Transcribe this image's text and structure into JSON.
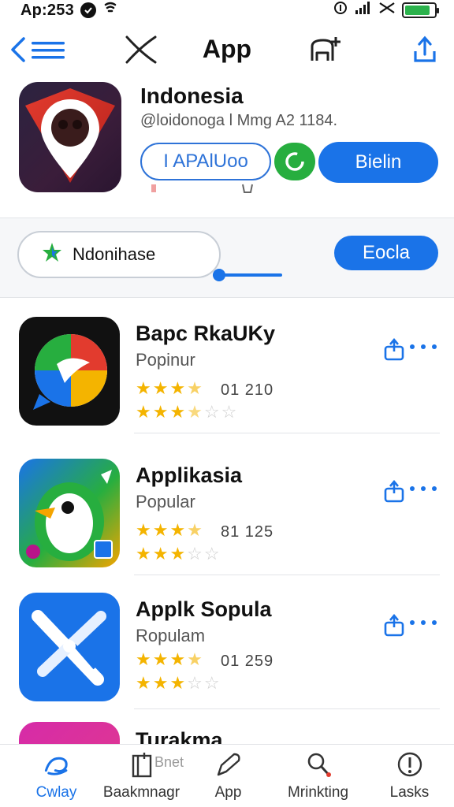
{
  "status": {
    "time": "Ap:253",
    "battery_level": 0.85
  },
  "nav": {
    "title": "App"
  },
  "hero": {
    "name": "Indonesia",
    "subtitle": "@loidonoga l Mmg A2 1184.",
    "outline_button": "I APAlUoo",
    "primary_button": "Bielin"
  },
  "search": {
    "value": "Ndonihase",
    "button": "Eocla"
  },
  "apps": [
    {
      "name": "Bapc RkaUKy",
      "category": "Popinur",
      "count": "01 210",
      "rating": 3.5,
      "rating2": 3.5
    },
    {
      "name": "Applikasia",
      "category": "Popular",
      "count": "81 125",
      "rating": 3.5,
      "rating2": 3
    },
    {
      "name": "Applk Sopula",
      "category": "Ropulam",
      "count": "01 259",
      "rating": 3.5,
      "rating2": 3
    },
    {
      "name": "Turakma"
    }
  ],
  "tabs": [
    {
      "label": "Cwlay"
    },
    {
      "label": "Baakmnagr",
      "overlay": "Bnet"
    },
    {
      "label": "App"
    },
    {
      "label": "Mrinkting"
    },
    {
      "label": "Lasks"
    }
  ],
  "colors": {
    "accent": "#1a73e8",
    "green": "#27ae3f",
    "star": "#f4b400"
  }
}
